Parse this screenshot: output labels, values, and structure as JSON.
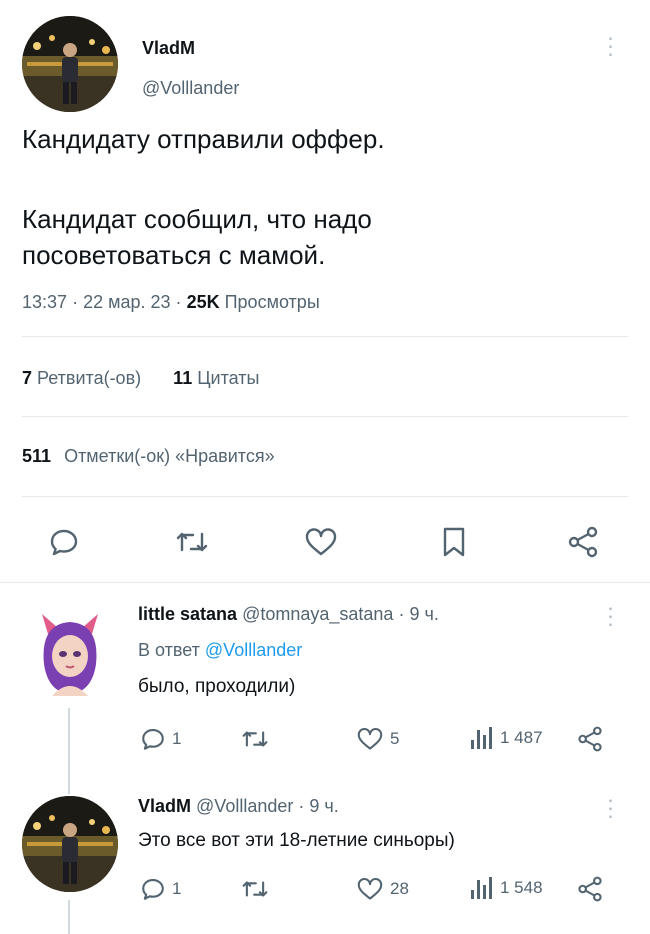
{
  "main_tweet": {
    "author": {
      "name": "VladM",
      "handle": "@Volllander"
    },
    "text_line1": "Кандидату отправили оффер.",
    "text_line2": "Кандидат сообщил, что надо",
    "text_line3": "посоветоваться с мамой.",
    "meta": {
      "time": "13:37",
      "date": "22 мар. 23",
      "views_count": "25K",
      "views_label": "Просмотры",
      "sep": "·"
    },
    "stats": {
      "retweets_count": "7",
      "retweets_label": "Ретвита(-ов)",
      "quotes_count": "11",
      "quotes_label": "Цитаты",
      "likes_count": "511",
      "likes_label": "Отметки(-ок) «Нравится»"
    }
  },
  "replies": [
    {
      "name": "little satana",
      "handle": "@tomnaya_satana",
      "time": "9 ч.",
      "reply_to_prefix": "В ответ",
      "reply_to_handle": "@Volllander",
      "text": "было, проходили)",
      "comments": "1",
      "likes": "5",
      "views": "1 487"
    },
    {
      "name": "VladM",
      "handle": "@Volllander",
      "time": "9 ч.",
      "text": "Это все вот эти 18-летние синьоры)",
      "comments": "1",
      "likes": "28",
      "views": "1 548"
    }
  ],
  "icons": {
    "reply": "speech-bubble-icon",
    "retweet": "retweet-icon",
    "like": "heart-icon",
    "bookmark": "bookmark-icon",
    "share": "share-icon",
    "views": "bar-chart-icon",
    "more": "more-dots-icon"
  },
  "colors": {
    "text": "#0f1419",
    "secondary": "#536471",
    "accent": "#1d9bf0",
    "divider": "#e7e9ea"
  }
}
